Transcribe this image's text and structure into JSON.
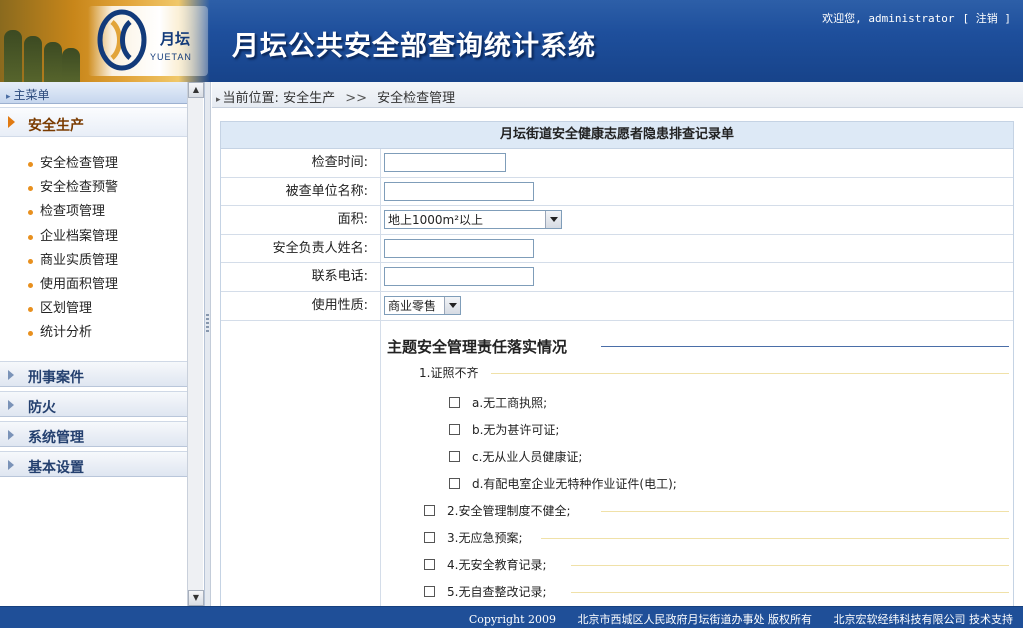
{
  "header": {
    "logo_cn": "月坛",
    "logo_en": "YUETAN",
    "system_title": "月坛公共安全部查询统计系统",
    "welcome_text": "欢迎您, administrator",
    "logout_label": "[ 注销 ]"
  },
  "sidebar": {
    "menu_title": "主菜单",
    "active_group": "安全生产",
    "sub_items": [
      "安全检查管理",
      "安全检查预警",
      "检查项管理",
      "企业档案管理",
      "商业实质管理",
      "使用面积管理",
      "区划管理",
      "统计分析"
    ],
    "groups": [
      "刑事案件",
      "防火",
      "系统管理",
      "基本设置"
    ]
  },
  "breadcrumb": {
    "prefix": "当前位置:",
    "level1": "安全生产",
    "separator": ">>",
    "level2": "安全检查管理"
  },
  "form": {
    "title": "月坛街道安全健康志愿者隐患排查记录单",
    "fields": {
      "check_time": {
        "label": "检查时间:",
        "value": ""
      },
      "unit_name": {
        "label": "被查单位名称:",
        "value": ""
      },
      "area": {
        "label": "面积:",
        "selected": "地上1000m²以上"
      },
      "safety_officer": {
        "label": "安全负责人姓名:",
        "value": ""
      },
      "phone": {
        "label": "联系电话:",
        "value": ""
      },
      "usage_type": {
        "label": "使用性质:",
        "selected": "商业零售"
      }
    },
    "section_title": "主题安全管理责任落实情况",
    "item1": "1.证照不齐",
    "item1_subs": [
      "a.无工商执照;",
      "b.无为甚许可证;",
      "c.无从业人员健康证;",
      "d.有配电室企业无特种作业证件(电工);"
    ],
    "items": [
      "2.安全管理制度不健全;",
      "3.无应急预案;",
      "4.无安全教育记录;",
      "5.无自查整改记录;"
    ]
  },
  "footer": {
    "copyright": "Copyright 2009",
    "owner": "北京市西城区人民政府月坛街道办事处 版权所有",
    "support": "北京宏软经纬科技有限公司 技术支持"
  }
}
